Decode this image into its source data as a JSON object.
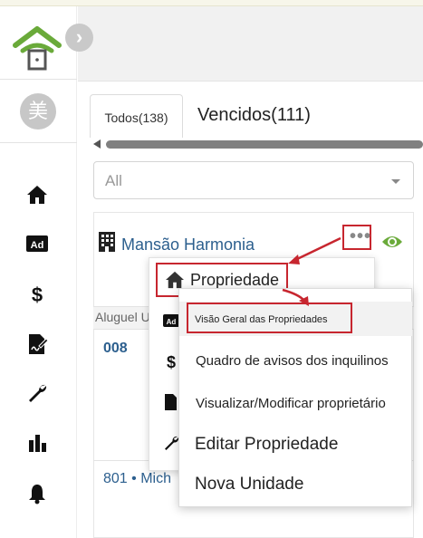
{
  "sidebar": {
    "avatar_text": "美",
    "toggle_icon": "chevron-right-icon",
    "nav_icons": [
      "home-icon",
      "ad-icon",
      "dollar-icon",
      "contract-sign-icon",
      "wrench-icon",
      "bar-chart-icon",
      "bell-icon"
    ]
  },
  "tabs": {
    "all_label": "Todos(138)",
    "overdue_label": "Vencidos(111)"
  },
  "filter": {
    "value": "All"
  },
  "property": {
    "name": "Mansão Harmonia",
    "more_label": "•••",
    "section_label": "Aluguel U"
  },
  "units": [
    {
      "number": "008"
    },
    {
      "number": "801 • Mich"
    }
  ],
  "context_menu": {
    "title": "Propriedade",
    "side_icons": [
      "ad-icon",
      "dollar-icon",
      "contract-sign-icon",
      "wrench-icon"
    ]
  },
  "submenu": {
    "items": [
      "Visão Geral das Propriedades",
      "Quadro de avisos dos inquilinos",
      "Visualizar/Modificar proprietário",
      "Editar Propriedade",
      "Nova Unidade"
    ]
  },
  "colors": {
    "brand_green": "#6aaa3a",
    "link_blue": "#2c5f8e",
    "annotation_red": "#c7262f"
  }
}
